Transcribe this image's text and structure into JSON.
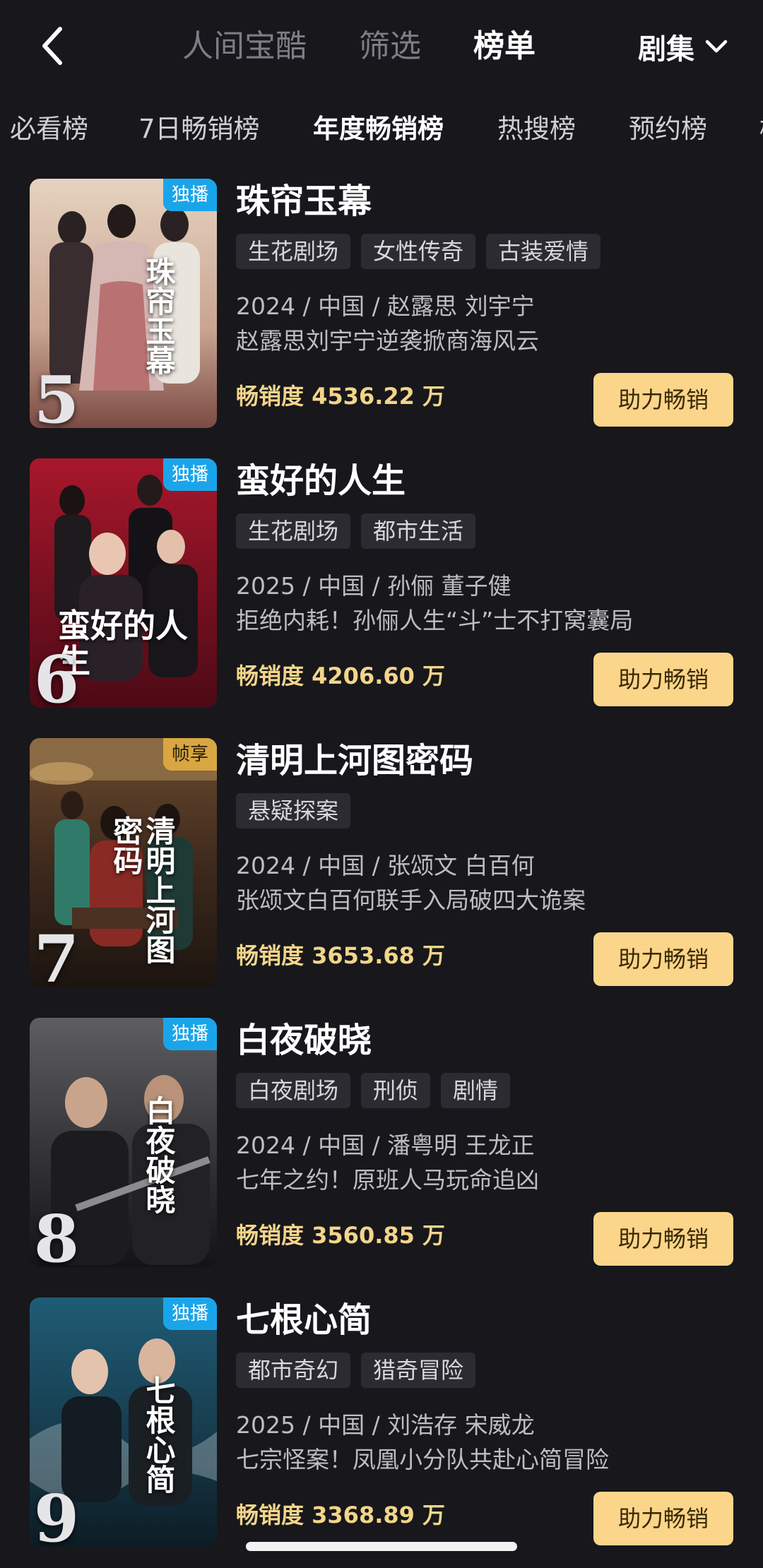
{
  "header": {
    "tabs": [
      {
        "label": "人间宝酷",
        "active": false
      },
      {
        "label": "筛选",
        "active": false
      },
      {
        "label": "榜单",
        "active": true
      }
    ],
    "category": "剧集"
  },
  "rank_tabs": [
    {
      "label": "必看榜",
      "active": false
    },
    {
      "label": "7日畅销榜",
      "active": false
    },
    {
      "label": "年度畅销榜",
      "active": true
    },
    {
      "label": "热搜榜",
      "active": false
    },
    {
      "label": "预约榜",
      "active": false
    }
  ],
  "shows": [
    {
      "rank": "5",
      "badge": "独播",
      "title": "珠帘玉幕",
      "poster_text": "珠帘玉幕",
      "tags": [
        "生花剧场",
        "女性传奇",
        "古装爱情"
      ],
      "meta": "2024 / 中国 / 赵露思 刘宇宁",
      "desc": "赵露思刘宇宁逆袭掀商海风云",
      "sales": "畅销度 4536.22 万",
      "button": "助力畅销"
    },
    {
      "rank": "6",
      "badge": "独播",
      "title": "蛮好的人生",
      "poster_text": "蛮好的人生",
      "tags": [
        "生花剧场",
        "都市生活"
      ],
      "meta": "2025 / 中国 / 孙俪 董子健",
      "desc": "拒绝内耗！孙俪人生“斗”士不打窝囊局",
      "sales": "畅销度 4206.60 万",
      "button": "助力畅销"
    },
    {
      "rank": "7",
      "badge": "帧享",
      "title": "清明上河图密码",
      "poster_text": "清明上河图密码",
      "tags": [
        "悬疑探案"
      ],
      "meta": "2024 / 中国 / 张颂文 白百何",
      "desc": "张颂文白百何联手入局破四大诡案",
      "sales": "畅销度 3653.68 万",
      "button": "助力畅销"
    },
    {
      "rank": "8",
      "badge": "独播",
      "title": "白夜破晓",
      "poster_text": "白夜破晓",
      "tags": [
        "白夜剧场",
        "刑侦",
        "剧情"
      ],
      "meta": "2024 / 中国 / 潘粤明 王龙正",
      "desc": "七年之约！原班人马玩命追凶",
      "sales": "畅销度 3560.85 万",
      "button": "助力畅销"
    },
    {
      "rank": "9",
      "badge": "独播",
      "title": "七根心简",
      "poster_text": "七根心简",
      "tags": [
        "都市奇幻",
        "猎奇冒险"
      ],
      "meta": "2025 / 中国 / 刘浩存 宋威龙",
      "desc": "七宗怪案！凤凰小分队共赴心简冒险",
      "sales": "畅销度 3368.89 万",
      "button": "助力畅销"
    }
  ],
  "colors": {
    "background": "#17171c",
    "sales_text": "#f3d589",
    "button_bg": "#fbd58a",
    "badge_blue": "#1aa5ea",
    "badge_gold": "#d8a642"
  }
}
